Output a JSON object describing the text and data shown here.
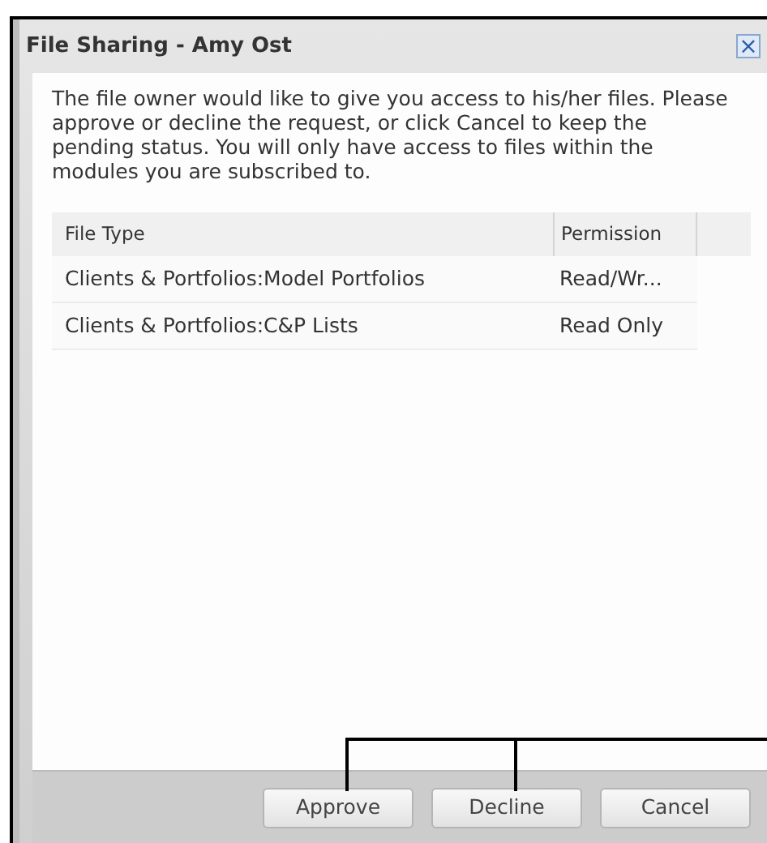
{
  "dialog": {
    "title": "File Sharing - Amy Ost",
    "close": "×",
    "message": "The file owner would like to give you access to his/her files. Please approve or decline the request, or click Cancel to keep the pending status. You will only have access to files within the modules you are subscribed to.",
    "table": {
      "columns": [
        "File Type",
        "Permission"
      ],
      "rows": [
        [
          "Clients & Portfolios:Model Portfolios",
          "Read/Wr..."
        ],
        [
          "Clients & Portfolios:C&P Lists",
          "Read Only"
        ]
      ]
    },
    "buttons": [
      "Approve",
      "Decline",
      "Cancel"
    ]
  }
}
